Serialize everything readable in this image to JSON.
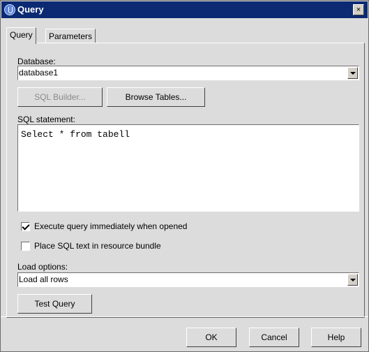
{
  "window": {
    "title": "Query",
    "close_glyph": "×"
  },
  "tabs": [
    {
      "label": "Query",
      "selected": true
    },
    {
      "label": "Parameters",
      "selected": false
    }
  ],
  "database": {
    "label": "Database:",
    "value": "database1"
  },
  "buttons": {
    "sql_builder": "SQL Builder...",
    "browse_tables": "Browse Tables...",
    "test_query": "Test Query",
    "ok": "OK",
    "cancel": "Cancel",
    "help": "Help"
  },
  "sql": {
    "label": "SQL statement:",
    "value": "Select * from tabell"
  },
  "options": {
    "execute_immediately": {
      "label": "Execute query immediately when opened",
      "checked": true
    },
    "place_sql_bundle": {
      "label": "Place SQL text in resource bundle",
      "checked": false
    }
  },
  "load_options": {
    "label": "Load options:",
    "value": "Load all rows"
  },
  "icons": {
    "title_icon": "app-icon",
    "close_icon": "close-icon",
    "dropdown_icon": "chevron-down-icon"
  }
}
